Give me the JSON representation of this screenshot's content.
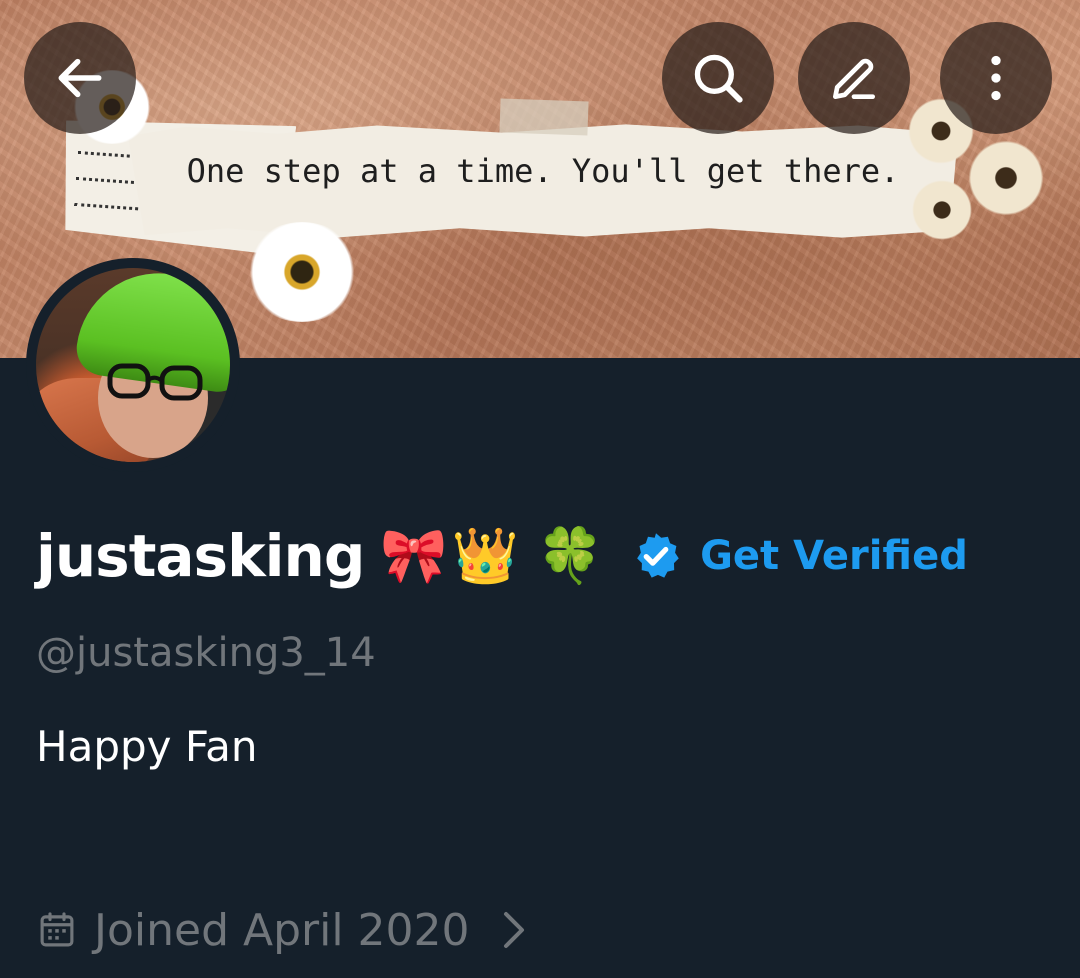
{
  "header": {
    "banner_quote": "One step at a time. You'll get there.",
    "back_icon": "arrow-left-icon",
    "search_icon": "search-icon",
    "edit_icon": "pencil-icon",
    "more_icon": "more-vertical-icon"
  },
  "profile": {
    "display_name": "justasking",
    "name_emojis": "🎀👑",
    "name_emoji_clover": "🍀",
    "verified_label": "Get Verified",
    "handle": "@justasking3_14",
    "bio": "Happy Fan",
    "joined": "Joined April 2020"
  },
  "colors": {
    "background": "#15202b",
    "accent": "#1d9bf0",
    "secondary_text": "#71767b",
    "primary_text": "#ffffff"
  }
}
